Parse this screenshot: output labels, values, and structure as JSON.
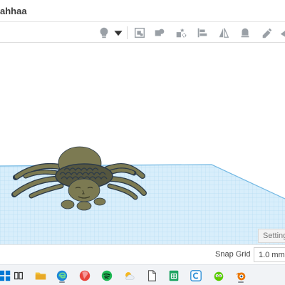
{
  "titlebar": {
    "project_name": "ahhaa"
  },
  "toolbar": {
    "icons": [
      "lightbulb-icon",
      "dropdown-arrow-icon",
      "note-icon",
      "shape-group-icon",
      "hole-icon",
      "align-icon",
      "mirror-icon",
      "group-icon",
      "flip-icon",
      "workplane-icon"
    ]
  },
  "viewport": {
    "settings_label": "Settings",
    "workplane_color": "#d8eefb",
    "grid_color": "#a9d4ef",
    "model_color": "#7c7a52",
    "model_outline": "#2b3a4a"
  },
  "status": {
    "snap_grid_label": "Snap Grid",
    "snap_grid_value": "1.0 mm"
  },
  "taskbar": {
    "apps": [
      "start-icon",
      "task-view-icon",
      "file-explorer-icon",
      "edge-icon",
      "paint-3d-icon",
      "spotify-icon",
      "weather-icon",
      "notepad-icon",
      "sheets-icon",
      "canva-icon",
      "duolingo-icon",
      "blender-icon"
    ]
  }
}
